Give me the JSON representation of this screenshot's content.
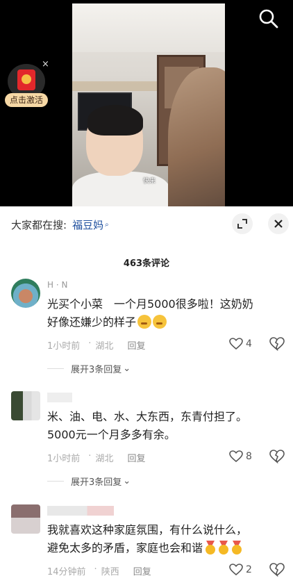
{
  "video": {
    "caption": "快来",
    "redpacket_label": "点击激活",
    "close_glyph": "×"
  },
  "search": {
    "prefix": "大家都在搜:",
    "term": "福豆妈",
    "term_icon": "⌕"
  },
  "comments_header": {
    "count_label": "463条评论"
  },
  "comments": [
    {
      "name": "H · N",
      "text_line1": "光买个小菜　一个月5000很多啦！这奶奶",
      "text_line2": "好像还嫌少的样子",
      "time": "1小时前",
      "location": "湖北",
      "reply_label": "回复",
      "likes": "4",
      "expand_label": "展开3条回复"
    },
    {
      "name": "",
      "text_line1": "米、油、电、水、大东西，东青付担了。",
      "text_line2": "5000元一个月多多有余。",
      "time": "1小时前",
      "location": "湖北",
      "reply_label": "回复",
      "likes": "8",
      "expand_label": "展开3条回复"
    },
    {
      "name": "",
      "text_line1": "我就喜欢这种家庭氛围，有什么说什么，",
      "text_line2": "避免太多的矛盾，家庭也会和谐",
      "time": "14分钟前",
      "location": "陕西",
      "reply_label": "回复",
      "likes": "2"
    }
  ],
  "colors": {
    "accent_link": "#1e4f9e",
    "redpacket": "#e2282b"
  }
}
